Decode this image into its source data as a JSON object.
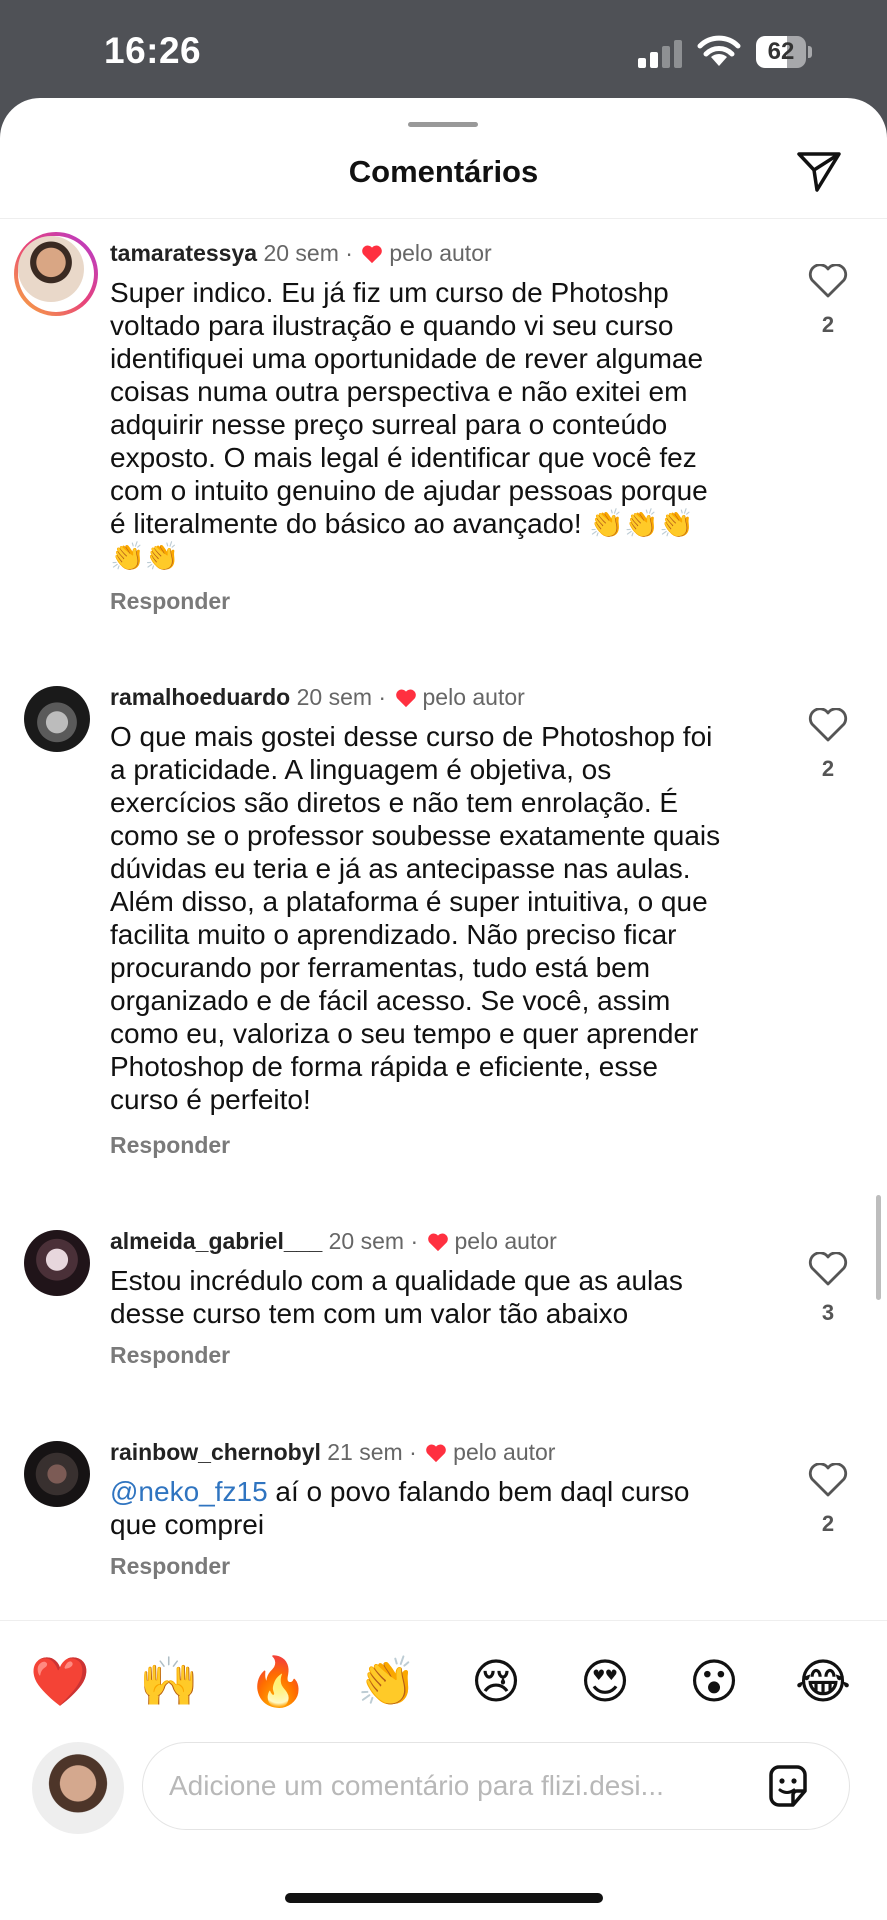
{
  "status_bar": {
    "time": "16:26",
    "battery": "62",
    "battery_level": 0.62
  },
  "header": {
    "title": "Comentários"
  },
  "author_badge": "pelo autor",
  "reply_label": "Responder",
  "comments": [
    {
      "username": "tamaratessya",
      "time": "20 sem",
      "lines": [
        "Super indico. Eu já fiz um curso de Photoshp",
        "voltado para ilustração e quando vi seu curso",
        "identifiquei uma oportunidade de rever algumae",
        "coisas numa outra perspectiva e não exitei em",
        "adquirir nesse preço surreal para o conteúdo",
        "exposto. O mais legal é identificar que você fez",
        "com o intuito genuino de ajudar pessoas porque",
        "é literalmente do básico ao avançado! 👏👏👏",
        "👏👏"
      ],
      "likes": "2"
    },
    {
      "username": "ramalhoeduardo",
      "time": "20 sem",
      "lines": [
        "O que mais gostei desse curso de Photoshop foi",
        "a praticidade. A linguagem é objetiva, os",
        "exercícios são diretos e não tem enrolação. É",
        "como se o professor soubesse exatamente quais",
        "dúvidas eu teria e já as antecipasse nas aulas.",
        "Além disso, a plataforma é super intuitiva, o que",
        "facilita muito o aprendizado. Não preciso ficar",
        "procurando por ferramentas, tudo está bem",
        "organizado e de fácil acesso. Se você, assim",
        "como eu, valoriza o seu tempo e quer aprender",
        "Photoshop de forma rápida e eficiente, esse",
        "curso é perfeito!"
      ],
      "likes": "2"
    },
    {
      "username": "almeida_gabriel___",
      "time": "20 sem",
      "lines": [
        "Estou incrédulo com a qualidade que as aulas",
        "desse curso tem com um valor tão abaixo"
      ],
      "likes": "3"
    },
    {
      "username": "rainbow_chernobyl",
      "time": "21 sem",
      "mention": "@neko_fz15",
      "lines": [
        " aí o povo falando bem daql curso",
        "que comprei"
      ],
      "likes": "2"
    }
  ],
  "reactions": [
    "❤️",
    "🙌",
    "🔥",
    "👏",
    "😢",
    "😍",
    "😮",
    "😂"
  ],
  "composer": {
    "placeholder": "Adicione um comentário para flizi.desi..."
  },
  "icons": {
    "share": "paper-plane-icon",
    "like": "heart-outline-icon",
    "author_like": "heart-filled-icon",
    "sticker": "sticker-icon"
  },
  "colors": {
    "heart": "#ff3040",
    "mention": "#2f74c0",
    "badge_text": "#666666"
  }
}
